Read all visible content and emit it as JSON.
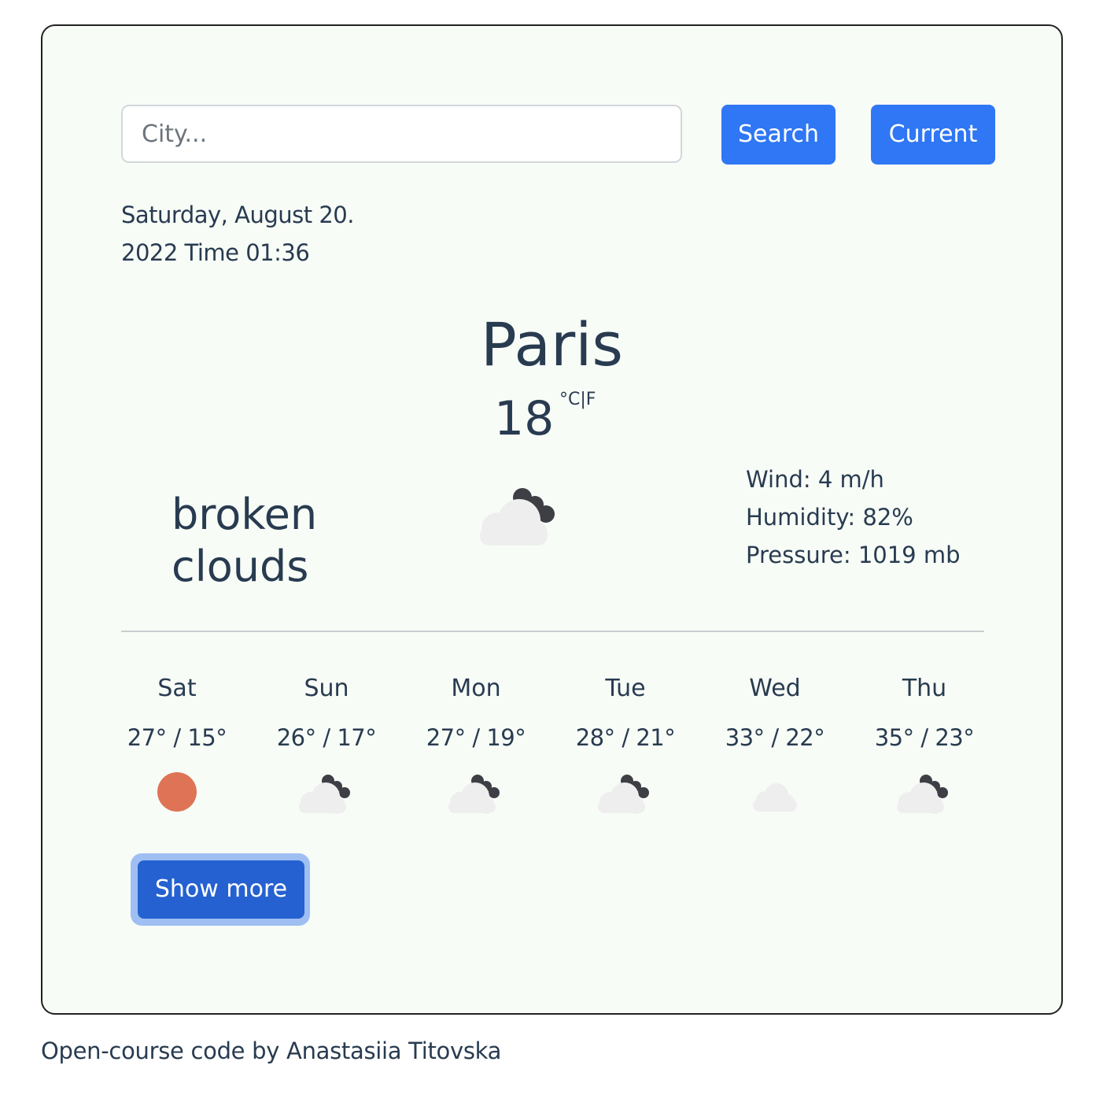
{
  "search": {
    "placeholder": "City...",
    "value": "",
    "search_label": "Search",
    "current_label": "Current"
  },
  "date": {
    "line1": "Saturday, August 20.",
    "line2": "2022 Time 01:36"
  },
  "current": {
    "city": "Paris",
    "temperature": "18",
    "unit_c": "°C",
    "unit_separator": "|",
    "unit_f": "F",
    "description_line1": "broken",
    "description_line2": "clouds",
    "icon": "broken-clouds-icon",
    "wind": "Wind: 4 m/h",
    "humidity": "Humidity: 82%",
    "pressure": "Pressure: 1019 mb"
  },
  "forecast": [
    {
      "day": "Sat",
      "temps": "27° / 15°",
      "icon": "sun-icon"
    },
    {
      "day": "Sun",
      "temps": "26° / 17°",
      "icon": "broken-clouds-icon"
    },
    {
      "day": "Mon",
      "temps": "27° / 19°",
      "icon": "broken-clouds-icon"
    },
    {
      "day": "Tue",
      "temps": "28° / 21°",
      "icon": "broken-clouds-icon"
    },
    {
      "day": "Wed",
      "temps": "33° / 22°",
      "icon": "cloud-icon"
    },
    {
      "day": "Thu",
      "temps": "35° / 23°",
      "icon": "broken-clouds-icon"
    }
  ],
  "show_more_label": "Show more",
  "footer": {
    "link_text": "Open-course code",
    "suffix": " by Anastasiia Titovska"
  },
  "colors": {
    "accent": "#2f77f4",
    "accent_dark": "#2561d0",
    "card_background": "#f8fcf7",
    "text": "#283b50",
    "sun": "#de7455",
    "cloud_light": "#eeeeee",
    "cloud_dark": "#3d3f44"
  }
}
